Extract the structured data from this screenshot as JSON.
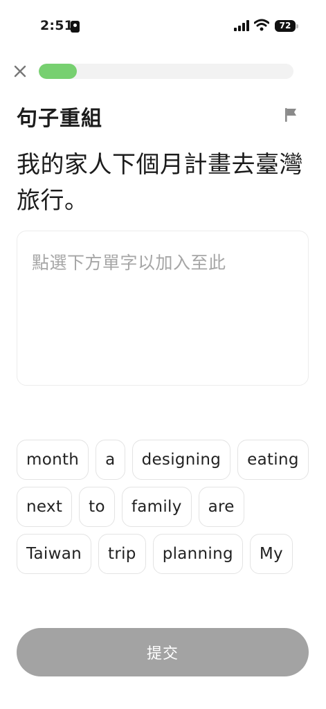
{
  "status_bar": {
    "time": "2:51",
    "battery": "72"
  },
  "progress": {
    "fraction": 0.15,
    "color": "#77d070"
  },
  "exercise": {
    "title": "句子重組",
    "prompt": "我的家人下個月計畫去臺灣旅行。",
    "answer_placeholder": "點選下方單字以加入至此"
  },
  "word_bank": {
    "rows": [
      [
        "month",
        "a",
        "designing",
        "eating"
      ],
      [
        "next",
        "to",
        "family",
        "are"
      ],
      [
        "Taiwan",
        "trip",
        "planning",
        "My"
      ]
    ]
  },
  "submit": {
    "label": "提交",
    "color": "#a3a3a3"
  },
  "icons": {
    "close": "close-icon",
    "flag": "flag-icon",
    "signal": "signal-icon",
    "wifi": "wifi-icon"
  }
}
